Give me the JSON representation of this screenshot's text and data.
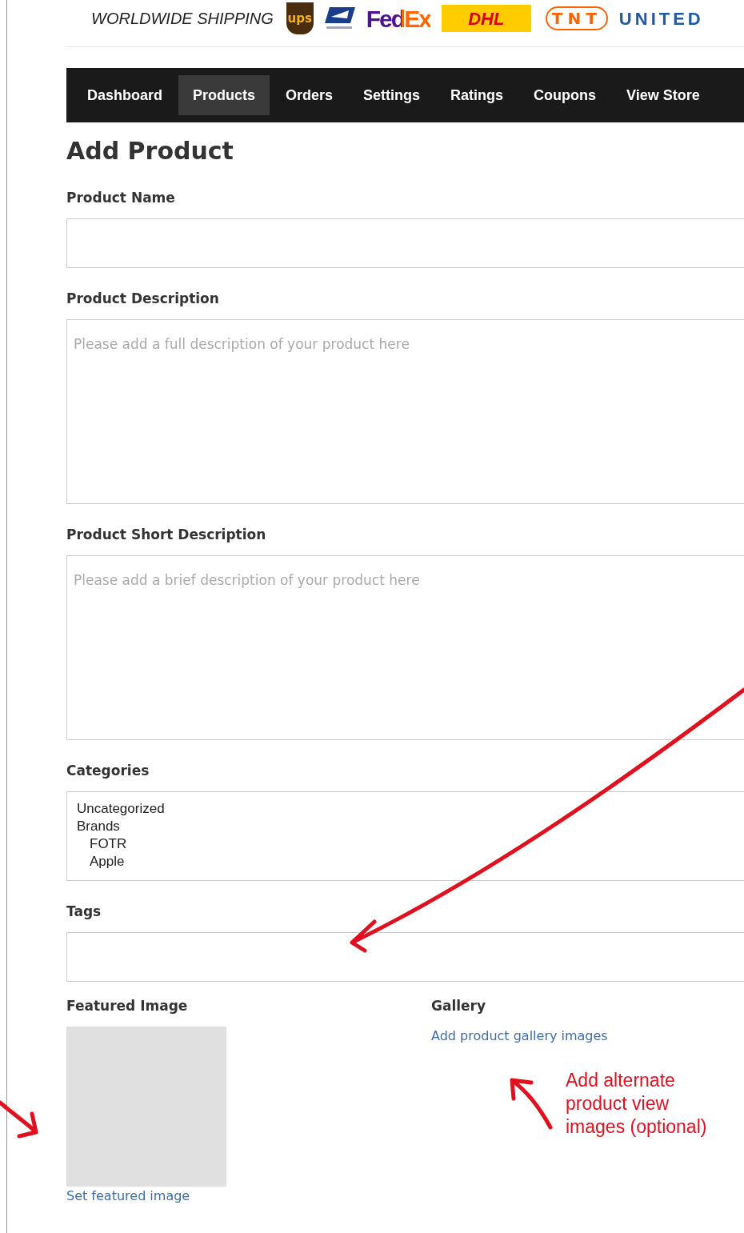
{
  "shipping_banner": {
    "label": "WORLDWIDE SHIPPING",
    "carriers": [
      {
        "kind": "ups",
        "text": "ups"
      },
      {
        "kind": "usps"
      },
      {
        "kind": "fedex",
        "text": "FedEx"
      },
      {
        "kind": "dhl",
        "text": "DHL"
      },
      {
        "kind": "tnt",
        "text": "TNT"
      },
      {
        "kind": "united",
        "text": "UNITED"
      }
    ]
  },
  "nav": [
    {
      "label": "Dashboard",
      "selected": false
    },
    {
      "label": "Products",
      "selected": true
    },
    {
      "label": "Orders",
      "selected": false
    },
    {
      "label": "Settings",
      "selected": false
    },
    {
      "label": "Ratings",
      "selected": false
    },
    {
      "label": "Coupons",
      "selected": false
    },
    {
      "label": "View Store",
      "selected": false
    }
  ],
  "title": "Add Product",
  "fields": [
    {
      "kind": "input",
      "label": "Product Name"
    },
    {
      "kind": "textarea",
      "label": "Product Description",
      "placeholder": "Please add a full description of your product here"
    },
    {
      "kind": "textarea",
      "label": "Product Short Description",
      "placeholder": "Please add a brief description of your product here"
    },
    {
      "kind": "list",
      "label": "Categories",
      "options": [
        {
          "label": "Uncategorized"
        },
        {
          "label": "Brands",
          "children": [
            {
              "label": "FOTR"
            },
            {
              "label": "Apple"
            }
          ]
        }
      ]
    },
    {
      "kind": "input",
      "label": "Tags"
    }
  ],
  "featured_image": {
    "label": "Featured Image",
    "link": "Set featured image"
  },
  "gallery": {
    "label": "Gallery",
    "link": "Add product gallery images"
  },
  "annotation": {
    "text": "Add alternate product view images (optional)"
  }
}
